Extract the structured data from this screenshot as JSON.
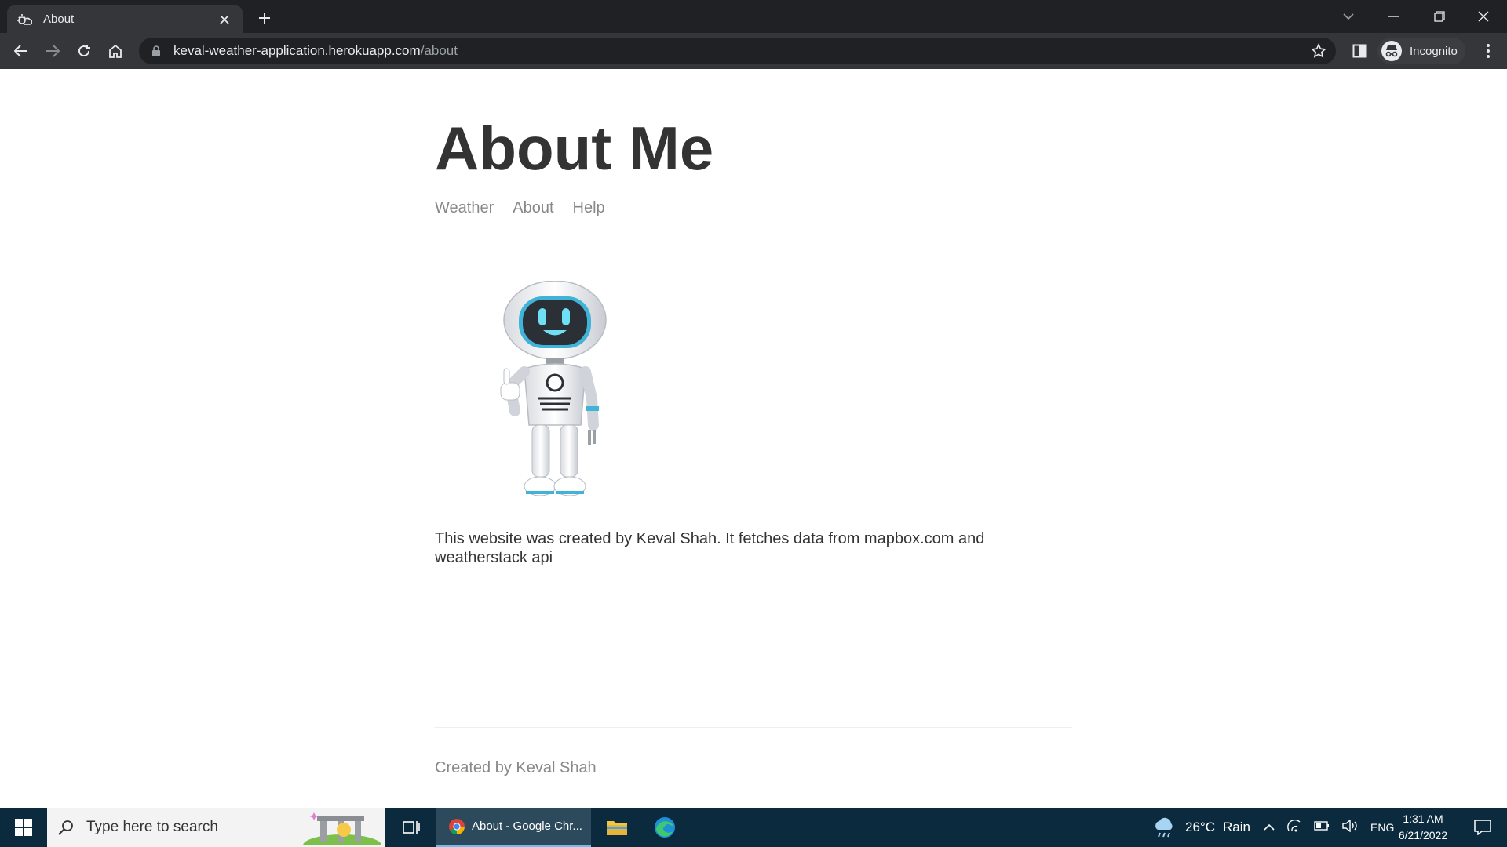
{
  "browser": {
    "tab_title": "About",
    "url_host": "keval-weather-application.herokuapp.com",
    "url_path": "/about",
    "profile_label": "Incognito"
  },
  "page": {
    "title": "About Me",
    "nav": [
      "Weather",
      "About",
      "Help"
    ],
    "about_text": "This website was created by Keval Shah. It fetches data from mapbox.com and weatherstack api",
    "footer": "Created by Keval Shah",
    "image": "robot-thumbs-up"
  },
  "taskbar": {
    "search_placeholder": "Type here to search",
    "chrome_task_label": "About - Google Chr...",
    "weather_temp": "26°C",
    "weather_condition": "Rain",
    "language": "ENG",
    "time": "1:31 AM",
    "date": "6/21/2022"
  },
  "colors": {
    "heading": "#333333",
    "nav_link": "#888888",
    "chrome_dark": "#202124",
    "taskbar": "#0b2a3d"
  }
}
